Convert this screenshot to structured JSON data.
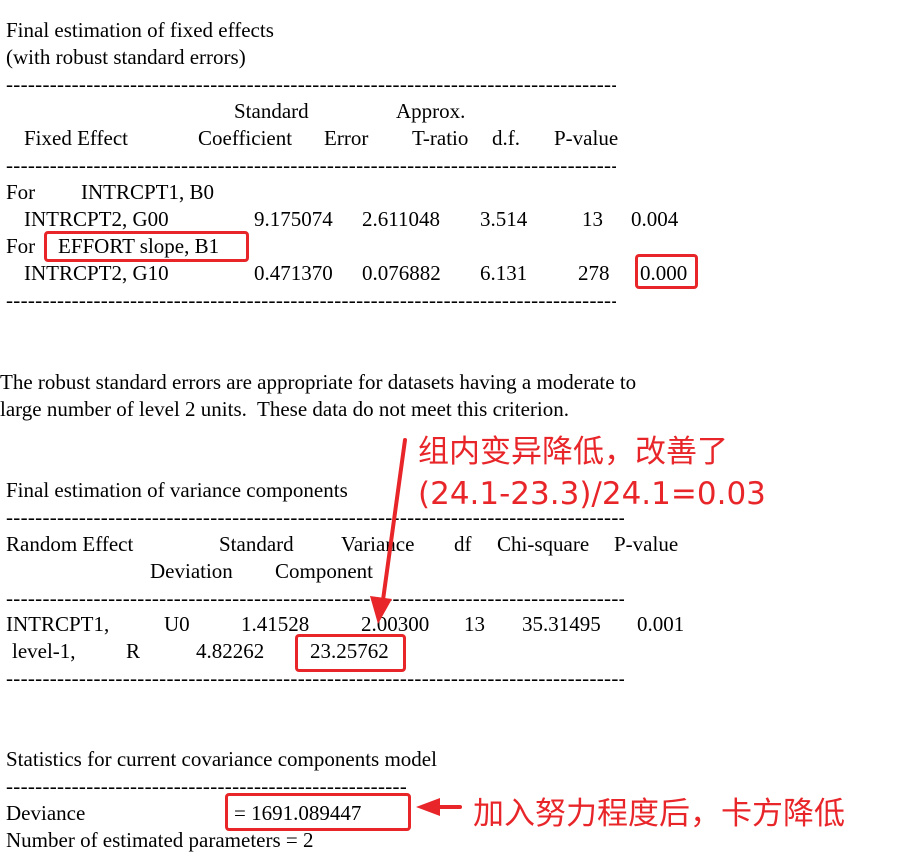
{
  "fixed": {
    "title1": "Final estimation of fixed effects",
    "title2": "(with robust standard errors)",
    "dashes": "------------------------------------------------------------------------------------------------------------------------------------------------",
    "hdr_standard": "Standard",
    "hdr_approx": "Approx.",
    "hdr_fixed_effect": "Fixed Effect",
    "hdr_coefficient": "Coefficient",
    "hdr_error": "Error",
    "hdr_tratio": "T-ratio",
    "hdr_df": "d.f.",
    "hdr_pvalue": "P-value",
    "for1_for": "For",
    "for1_name": "INTRCPT1, B0",
    "row1": {
      "effect": "INTRCPT2, G00",
      "coef": "9.175074",
      "se": "2.611048",
      "t": "3.514",
      "df": "13",
      "p": "0.004"
    },
    "for2_for": "For",
    "for2_name": "EFFORT slope, B1",
    "row2": {
      "effect": "INTRCPT2, G10",
      "coef": "0.471370",
      "se": "0.076882",
      "t": "6.131",
      "df": "278",
      "p": "0.000"
    }
  },
  "note": {
    "line1": "The robust standard errors are appropriate for datasets having a moderate to",
    "line2": "large number of level 2 units.  These data do not meet this criterion."
  },
  "variance": {
    "title": "Final estimation of variance components",
    "hdr_random_effect": "Random Effect",
    "hdr_standard": "Standard",
    "hdr_variance": "Variance",
    "hdr_df": "df",
    "hdr_chisq": "Chi-square",
    "hdr_pvalue": "P-value",
    "hdr_deviation": "Deviation",
    "hdr_component": "Component",
    "row1": {
      "effect": "INTRCPT1,",
      "code": "U0",
      "sd": "1.41528",
      "var": "2.00300",
      "df": "13",
      "chisq": "35.31495",
      "p": "0.001"
    },
    "row2": {
      "effect": "level-1,",
      "code": "R",
      "sd": "4.82262",
      "var": "23.25762"
    }
  },
  "stats": {
    "title": "Statistics for current covariance components model",
    "deviance_label": "Deviance",
    "deviance_value": "= 1691.089447",
    "params": "Number of estimated parameters = 2"
  },
  "annotations": {
    "variance_note_line1": "组内变异降低，改善了",
    "variance_note_line2": "(24.1-23.3)/24.1=0.03",
    "deviance_note": "加入努力程度后，卡方降低",
    "color": "#e8262a"
  }
}
